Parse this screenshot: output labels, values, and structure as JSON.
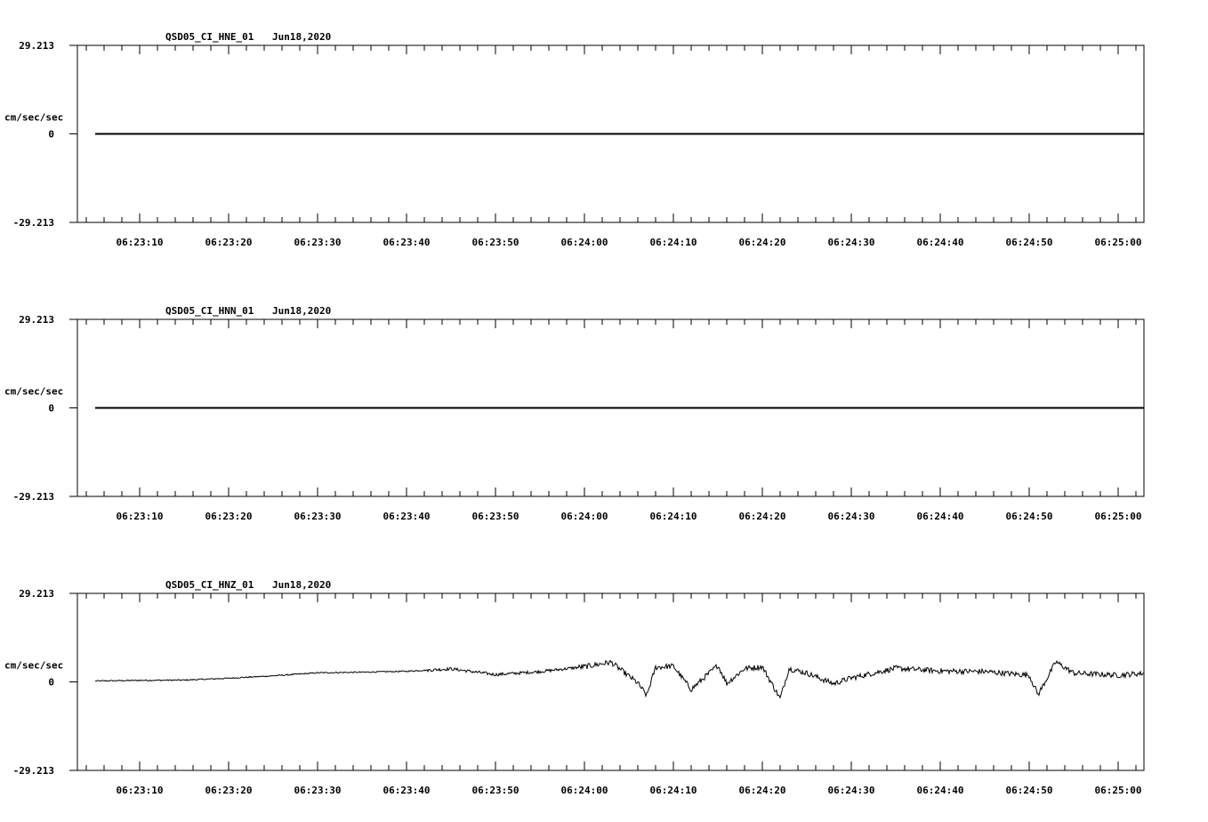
{
  "chart_data": [
    {
      "type": "line",
      "title": "QSD05_CI_HNE_01",
      "date": "Jun18,2020",
      "ylabel": "cm/sec/sec",
      "ylim": [
        -29.213,
        29.213
      ],
      "ytick_labels": [
        "29.213",
        "0",
        "-29.213"
      ],
      "x_tick_labels": [
        "06:23:10",
        "06:23:20",
        "06:23:30",
        "06:23:40",
        "06:23:50",
        "06:24:00",
        "06:24:10",
        "06:24:20",
        "06:24:30",
        "06:24:40",
        "06:24:50",
        "06:25:00"
      ],
      "series": [
        {
          "x": [
            "06:23:05",
            "06:25:03"
          ],
          "y": [
            0,
            0
          ]
        }
      ]
    },
    {
      "type": "line",
      "title": "QSD05_CI_HNN_01",
      "date": "Jun18,2020",
      "ylabel": "cm/sec/sec",
      "ylim": [
        -29.213,
        29.213
      ],
      "ytick_labels": [
        "29.213",
        "0",
        "-29.213"
      ],
      "x_tick_labels": [
        "06:23:10",
        "06:23:20",
        "06:23:30",
        "06:23:40",
        "06:23:50",
        "06:24:00",
        "06:24:10",
        "06:24:20",
        "06:24:30",
        "06:24:40",
        "06:24:50",
        "06:25:00"
      ],
      "series": [
        {
          "x": [
            "06:23:05",
            "06:25:03"
          ],
          "y": [
            0,
            0
          ]
        }
      ]
    },
    {
      "type": "line",
      "title": "QSD05_CI_HNZ_01",
      "date": "Jun18,2020",
      "ylabel": "cm/sec/sec",
      "ylim": [
        -29.213,
        29.213
      ],
      "ytick_labels": [
        "29.213",
        "0",
        "-29.213"
      ],
      "x_tick_labels": [
        "06:23:10",
        "06:23:20",
        "06:23:30",
        "06:23:40",
        "06:23:50",
        "06:24:00",
        "06:24:10",
        "06:24:20",
        "06:24:30",
        "06:24:40",
        "06:24:50",
        "06:25:00"
      ],
      "series": [
        {
          "x": [
            "06:23:05",
            "06:23:10",
            "06:23:15",
            "06:23:20",
            "06:23:25",
            "06:23:30",
            "06:23:35",
            "06:23:40",
            "06:23:45",
            "06:23:50",
            "06:23:55",
            "06:24:00",
            "06:24:03",
            "06:24:06",
            "06:24:07",
            "06:24:08",
            "06:24:10",
            "06:24:12",
            "06:24:15",
            "06:24:16",
            "06:24:18",
            "06:24:20",
            "06:24:22",
            "06:24:23",
            "06:24:25",
            "06:24:28",
            "06:24:30",
            "06:24:35",
            "06:24:40",
            "06:24:45",
            "06:24:50",
            "06:24:51",
            "06:24:53",
            "06:24:55",
            "06:25:00",
            "06:25:03"
          ],
          "y": [
            0.3,
            0.5,
            0.6,
            1.2,
            2.0,
            3.0,
            3.2,
            3.5,
            4.3,
            2.4,
            3.4,
            5.0,
            6.5,
            -0.4,
            -4.5,
            4.8,
            5.2,
            -2.5,
            5.5,
            -0.5,
            4.4,
            5.0,
            -5.5,
            4.4,
            2.9,
            -0.6,
            1.3,
            4.5,
            3.6,
            3.4,
            2.2,
            -4.2,
            6.6,
            2.9,
            2.2,
            2.9
          ]
        }
      ]
    }
  ]
}
